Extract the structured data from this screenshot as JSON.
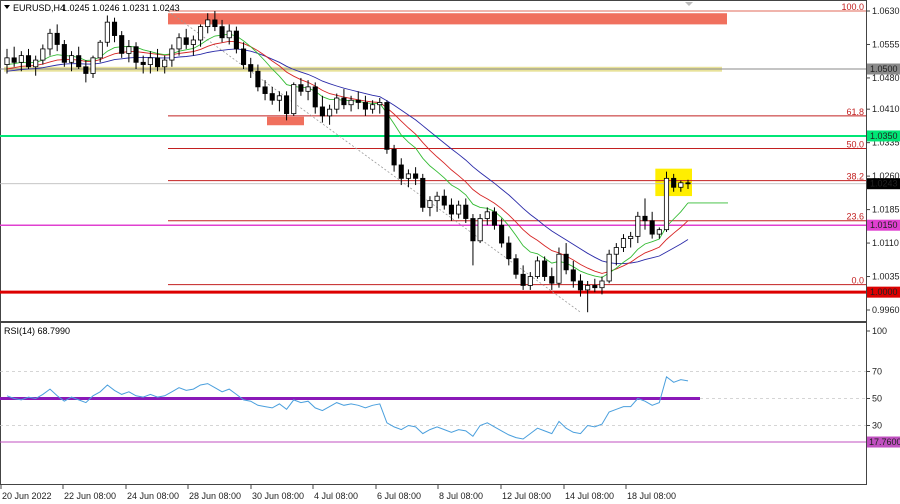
{
  "header": {
    "symbol": "EURUSD,H4",
    "ohlc": "1.0245 1.0246 1.0231 1.0243"
  },
  "rsi_header": "RSI(14) 68.7990",
  "colors": {
    "bull": "#ffffff",
    "bear": "#000000",
    "ma_fast": "#33bb33",
    "ma_mid": "#d62424",
    "ma_slow": "#2a2aa8",
    "resistance_zone": "#f0705e",
    "yellow_zone": "#e8e29a",
    "green_line": "#00e676",
    "magenta_line": "#e040d0",
    "support_line": "#dd0000",
    "rsi_line": "#4a9fdd",
    "rsi_50": "#8a19b8",
    "highlight": "#ffee00"
  },
  "chart_data": [
    {
      "type": "candlestick",
      "title": "EURUSD,H4",
      "ylim": [
        0.9925,
        1.0655
      ],
      "y_ticks": [
        "1.0630",
        "1.0555",
        "1.0480",
        "1.0410",
        "1.0335",
        "1.0260",
        "1.0185",
        "1.0110",
        "1.0035",
        "0.9960"
      ],
      "x_ticks": [
        "20 Jun 2022",
        "22 Jun 08:00",
        "24 Jun 08:00",
        "28 Jun 08:00",
        "30 Jun 08:00",
        "4 Jul 08:00",
        "6 Jul 08:00",
        "8 Jul 08:00",
        "12 Jul 08:00",
        "14 Jul 08:00",
        "18 Jul 08:00"
      ],
      "price_labels": [
        {
          "text": "1.0500",
          "value": 1.05,
          "bg": "#8a8a8a"
        },
        {
          "text": "1.0350",
          "value": 1.035,
          "bg": "#00e676"
        },
        {
          "text": "1.0243",
          "value": 1.0243,
          "bg": "#000000"
        },
        {
          "text": "1.0150",
          "value": 1.015,
          "bg": "#e040d0"
        },
        {
          "text": "1.0000",
          "value": 1.0,
          "bg": "#dd0000"
        }
      ],
      "fibonacci": [
        {
          "label": "100.0",
          "value": 1.063
        },
        {
          "label": "61.8",
          "value": 1.0395
        },
        {
          "label": "50.0",
          "value": 1.0322
        },
        {
          "label": "38.2",
          "value": 1.025
        },
        {
          "label": "23.6",
          "value": 1.016
        },
        {
          "label": "0.0",
          "value": 1.0017
        }
      ],
      "horizontal_levels": [
        {
          "name": "yellow-zone-level",
          "value": 1.05
        },
        {
          "name": "green-level",
          "value": 1.035
        },
        {
          "name": "magenta-level",
          "value": 1.015
        },
        {
          "name": "parity-level",
          "value": 1.0
        }
      ],
      "zones": [
        {
          "name": "resistance-zone",
          "y_top": 1.0625,
          "y_bottom": 1.06
        },
        {
          "name": "yellow-zone",
          "y_top": 1.0505,
          "y_bottom": 1.0494
        },
        {
          "name": "pink-block",
          "y_top": 1.0393,
          "y_bottom": 1.0374
        }
      ],
      "candles": [
        [
          1.051,
          1.0545,
          1.049,
          1.0525
        ],
        [
          1.0525,
          1.055,
          1.0505,
          1.0515
        ],
        [
          1.0515,
          1.054,
          1.0495,
          1.053
        ],
        [
          1.053,
          1.0545,
          1.05,
          1.0505
        ],
        [
          1.0505,
          1.053,
          1.0485,
          1.052
        ],
        [
          1.052,
          1.0555,
          1.051,
          1.0545
        ],
        [
          1.0545,
          1.059,
          1.053,
          1.058
        ],
        [
          1.058,
          1.06,
          1.054,
          1.0555
        ],
        [
          1.0555,
          1.0565,
          1.0505,
          1.0515
        ],
        [
          1.0515,
          1.054,
          1.0495,
          1.053
        ],
        [
          1.053,
          1.055,
          1.05,
          1.0505
        ],
        [
          1.0505,
          1.052,
          1.047,
          1.049
        ],
        [
          1.049,
          1.053,
          1.048,
          1.0525
        ],
        [
          1.0525,
          1.0565,
          1.0515,
          1.056
        ],
        [
          1.056,
          1.062,
          1.055,
          1.0605
        ],
        [
          1.0605,
          1.0615,
          1.056,
          1.0575
        ],
        [
          1.0575,
          1.0585,
          1.0525,
          1.0535
        ],
        [
          1.0535,
          1.0565,
          1.0515,
          1.055
        ],
        [
          1.055,
          1.056,
          1.05,
          1.0515
        ],
        [
          1.0515,
          1.053,
          1.049,
          1.051
        ],
        [
          1.051,
          1.054,
          1.049,
          1.0525
        ],
        [
          1.0525,
          1.0545,
          1.0495,
          1.0505
        ],
        [
          1.0505,
          1.053,
          1.049,
          1.052
        ],
        [
          1.052,
          1.0555,
          1.0505,
          1.0545
        ],
        [
          1.0545,
          1.058,
          1.053,
          1.057
        ],
        [
          1.057,
          1.059,
          1.0545,
          1.0555
        ],
        [
          1.0555,
          1.0575,
          1.053,
          1.0565
        ],
        [
          1.0565,
          1.06,
          1.055,
          1.0595
        ],
        [
          1.0595,
          1.0625,
          1.058,
          1.061
        ],
        [
          1.061,
          1.063,
          1.0585,
          1.0595
        ],
        [
          1.0595,
          1.061,
          1.056,
          1.057
        ],
        [
          1.057,
          1.06,
          1.0555,
          1.0585
        ],
        [
          1.0585,
          1.0595,
          1.0535,
          1.0545
        ],
        [
          1.0545,
          1.056,
          1.05,
          1.051
        ],
        [
          1.051,
          1.0525,
          1.048,
          1.0495
        ],
        [
          1.0495,
          1.051,
          1.045,
          1.046
        ],
        [
          1.046,
          1.0475,
          1.043,
          1.0445
        ],
        [
          1.0445,
          1.046,
          1.042,
          1.043
        ],
        [
          1.043,
          1.045,
          1.0405,
          1.044
        ],
        [
          1.044,
          1.045,
          1.0385,
          1.04
        ],
        [
          1.04,
          1.047,
          1.0395,
          1.0465
        ],
        [
          1.0465,
          1.048,
          1.044,
          1.045
        ],
        [
          1.045,
          1.0475,
          1.043,
          1.046
        ],
        [
          1.046,
          1.047,
          1.04,
          1.0415
        ],
        [
          1.0415,
          1.044,
          1.038,
          1.0395
        ],
        [
          1.0395,
          1.042,
          1.0375,
          1.041
        ],
        [
          1.041,
          1.0445,
          1.04,
          1.0435
        ],
        [
          1.0435,
          1.0455,
          1.041,
          1.042
        ],
        [
          1.042,
          1.044,
          1.0405,
          1.043
        ],
        [
          1.043,
          1.045,
          1.041,
          1.0425
        ],
        [
          1.0425,
          1.044,
          1.0395,
          1.041
        ],
        [
          1.041,
          1.043,
          1.04,
          1.042
        ],
        [
          1.042,
          1.0435,
          1.04,
          1.0425
        ],
        [
          1.0425,
          1.043,
          1.031,
          1.032
        ],
        [
          1.032,
          1.033,
          1.027,
          1.0285
        ],
        [
          1.0285,
          1.03,
          1.024,
          1.0255
        ],
        [
          1.0255,
          1.0275,
          1.0235,
          1.0265
        ],
        [
          1.0265,
          1.028,
          1.024,
          1.0255
        ],
        [
          1.0255,
          1.0265,
          1.018,
          1.019
        ],
        [
          1.019,
          1.0215,
          1.017,
          1.0205
        ],
        [
          1.0205,
          1.0225,
          1.018,
          1.0215
        ],
        [
          1.0215,
          1.023,
          1.0185,
          1.0195
        ],
        [
          1.0195,
          1.021,
          1.016,
          1.0175
        ],
        [
          1.0175,
          1.0205,
          1.0165,
          1.0195
        ],
        [
          1.0195,
          1.021,
          1.0155,
          1.0165
        ],
        [
          1.0165,
          1.0175,
          1.006,
          1.0115
        ],
        [
          1.0115,
          1.0175,
          1.011,
          1.0165
        ],
        [
          1.0165,
          1.019,
          1.015,
          1.018
        ],
        [
          1.018,
          1.019,
          1.014,
          1.015
        ],
        [
          1.015,
          1.0165,
          1.01,
          1.011
        ],
        [
          1.011,
          1.0125,
          1.006,
          1.0075
        ],
        [
          1.0075,
          1.0085,
          1.003,
          1.004
        ],
        [
          1.004,
          1.006,
          1.0005,
          1.0015
        ],
        [
          1.0015,
          1.0045,
          1.0005,
          1.0035
        ],
        [
          1.0035,
          1.008,
          1.003,
          1.007
        ],
        [
          1.007,
          1.008,
          1.0025,
          1.0035
        ],
        [
          1.0035,
          1.0055,
          1.0005,
          1.002
        ],
        [
          1.002,
          1.01,
          1.001,
          1.0085
        ],
        [
          1.0085,
          1.011,
          1.004,
          1.005
        ],
        [
          1.005,
          1.007,
          1.001,
          1.0025
        ],
        [
          1.0025,
          1.004,
          0.999,
          1.0005
        ],
        [
          1.0005,
          1.0025,
          0.9955,
          1.0015
        ],
        [
          1.0015,
          1.003,
          1.0,
          1.001
        ],
        [
          1.001,
          1.0035,
          0.9995,
          1.0025
        ],
        [
          1.0025,
          1.0095,
          1.002,
          1.0085
        ],
        [
          1.0085,
          1.011,
          1.006,
          1.01
        ],
        [
          1.01,
          1.013,
          1.009,
          1.012
        ],
        [
          1.012,
          1.0135,
          1.01,
          1.0125
        ],
        [
          1.0125,
          1.018,
          1.011,
          1.017
        ],
        [
          1.017,
          1.021,
          1.014,
          1.016
        ],
        [
          1.016,
          1.018,
          1.012,
          1.013
        ],
        [
          1.013,
          1.0145,
          1.012,
          1.014
        ],
        [
          1.014,
          1.027,
          1.0135,
          1.0255
        ],
        [
          1.0255,
          1.0265,
          1.0225,
          1.0235
        ],
        [
          1.0235,
          1.025,
          1.0225,
          1.0245
        ],
        [
          1.0245,
          1.0252,
          1.0231,
          1.0243
        ]
      ],
      "ma_fast": [
        1.051,
        1.0512,
        1.0515,
        1.0514,
        1.0515,
        1.052,
        1.0528,
        1.0532,
        1.053,
        1.0529,
        1.0526,
        1.0519,
        1.052,
        1.0527,
        1.054,
        1.0548,
        1.055,
        1.0551,
        1.0549,
        1.0543,
        1.0539,
        1.0535,
        1.0532,
        1.0534,
        1.054,
        1.0543,
        1.0546,
        1.0555,
        1.0566,
        1.0574,
        1.0576,
        1.0578,
        1.0574,
        1.0563,
        1.055,
        1.0535,
        1.0518,
        1.05,
        1.0484,
        1.0465,
        1.0461,
        1.0459,
        1.0458,
        1.045,
        1.0438,
        1.0432,
        1.0432,
        1.043,
        1.0429,
        1.0428,
        1.0424,
        1.0423,
        1.0423,
        1.0401,
        1.0377,
        1.0352,
        1.0336,
        1.0323,
        1.03,
        1.0283,
        1.027,
        1.0256,
        1.024,
        1.0231,
        1.0218,
        1.0197,
        1.019,
        1.0188,
        1.0181,
        1.0167,
        1.0149,
        1.0127,
        1.0104,
        1.009,
        1.0086,
        1.0076,
        1.0065,
        1.0069,
        1.0065,
        1.0057,
        1.0047,
        1.0041,
        1.0036,
        1.0033,
        1.0043,
        1.0054,
        1.0067,
        1.0078,
        1.0096,
        1.0108,
        1.0113,
        1.0119,
        1.0147,
        1.0164,
        1.018,
        1.02
      ],
      "ma_mid": [
        1.05,
        1.0503,
        1.0506,
        1.0507,
        1.0508,
        1.0511,
        1.0516,
        1.052,
        1.0521,
        1.0521,
        1.052,
        1.0517,
        1.0517,
        1.0521,
        1.0528,
        1.0534,
        1.0537,
        1.0539,
        1.0539,
        1.0537,
        1.0535,
        1.0533,
        1.0531,
        1.0532,
        1.0535,
        1.0537,
        1.0539,
        1.0544,
        1.0551,
        1.0556,
        1.0559,
        1.0562,
        1.0561,
        1.0557,
        1.055,
        1.0541,
        1.053,
        1.0518,
        1.0507,
        1.0493,
        1.0484,
        1.0476,
        1.047,
        1.0462,
        1.0452,
        1.0445,
        1.0441,
        1.0437,
        1.0434,
        1.0431,
        1.0428,
        1.0426,
        1.0425,
        1.0413,
        1.0399,
        1.0383,
        1.0368,
        1.0354,
        1.0335,
        1.0318,
        1.0303,
        1.0289,
        1.0274,
        1.0261,
        1.0247,
        1.023,
        1.0218,
        1.0209,
        1.0199,
        1.0187,
        1.0173,
        1.0157,
        1.014,
        1.0126,
        1.0116,
        1.0104,
        1.0093,
        1.0088,
        1.0081,
        1.0072,
        1.0062,
        1.0054,
        1.0047,
        1.0042,
        1.0046,
        1.0052,
        1.0059,
        1.0067,
        1.0078,
        1.0088,
        1.0094,
        1.0101,
        1.0118,
        1.0132,
        1.0145,
        1.016
      ],
      "ma_slow": [
        1.0495,
        1.0497,
        1.0499,
        1.05,
        1.0501,
        1.0503,
        1.0506,
        1.0509,
        1.0511,
        1.0512,
        1.0512,
        1.0511,
        1.0511,
        1.0513,
        1.0517,
        1.0521,
        1.0523,
        1.0525,
        1.0526,
        1.0526,
        1.0526,
        1.0525,
        1.0525,
        1.0525,
        1.0527,
        1.0528,
        1.053,
        1.0533,
        1.0537,
        1.054,
        1.0542,
        1.0544,
        1.0545,
        1.0543,
        1.054,
        1.0535,
        1.0529,
        1.0522,
        1.0515,
        1.0506,
        1.0499,
        1.0493,
        1.0488,
        1.0481,
        1.0473,
        1.0467,
        1.0462,
        1.0457,
        1.0453,
        1.0449,
        1.0445,
        1.0441,
        1.0438,
        1.0429,
        1.0419,
        1.0408,
        1.0397,
        1.0386,
        1.0373,
        1.036,
        1.0347,
        1.0334,
        1.0321,
        1.0309,
        1.0296,
        1.0281,
        1.0268,
        1.0256,
        1.0244,
        1.0231,
        1.0218,
        1.0203,
        1.0188,
        1.0174,
        1.0162,
        1.0149,
        1.0137,
        1.0127,
        1.0117,
        1.0107,
        1.0097,
        1.0087,
        1.0078,
        1.007,
        1.0066,
        1.0064,
        1.0064,
        1.0065,
        1.0068,
        1.0073,
        1.0077,
        1.0081,
        1.009,
        1.0099,
        1.0108,
        1.0118
      ]
    },
    {
      "type": "line",
      "title": "RSI(14) 68.7990",
      "ylim": [
        0,
        100
      ],
      "y_ticks": [
        "100",
        "70",
        "50",
        "30",
        "0"
      ],
      "levels": [
        70,
        50,
        30,
        17.76
      ],
      "level_label": "17.7600",
      "values": [
        52,
        50,
        49,
        51,
        50,
        53,
        57,
        52,
        48,
        51,
        49,
        47,
        52,
        55,
        60,
        56,
        53,
        55,
        52,
        51,
        53,
        51,
        52,
        55,
        58,
        56,
        57,
        60,
        61,
        58,
        55,
        57,
        53,
        49,
        48,
        45,
        44,
        43,
        46,
        42,
        49,
        47,
        48,
        43,
        41,
        44,
        47,
        45,
        46,
        45,
        43,
        45,
        46,
        32,
        29,
        27,
        30,
        29,
        24,
        27,
        29,
        27,
        25,
        27,
        26,
        22,
        30,
        32,
        29,
        26,
        23,
        21,
        20,
        24,
        28,
        26,
        24,
        33,
        28,
        25,
        24,
        30,
        29,
        31,
        40,
        42,
        44,
        44,
        50,
        48,
        45,
        47,
        66,
        62,
        64,
        63
      ]
    }
  ]
}
